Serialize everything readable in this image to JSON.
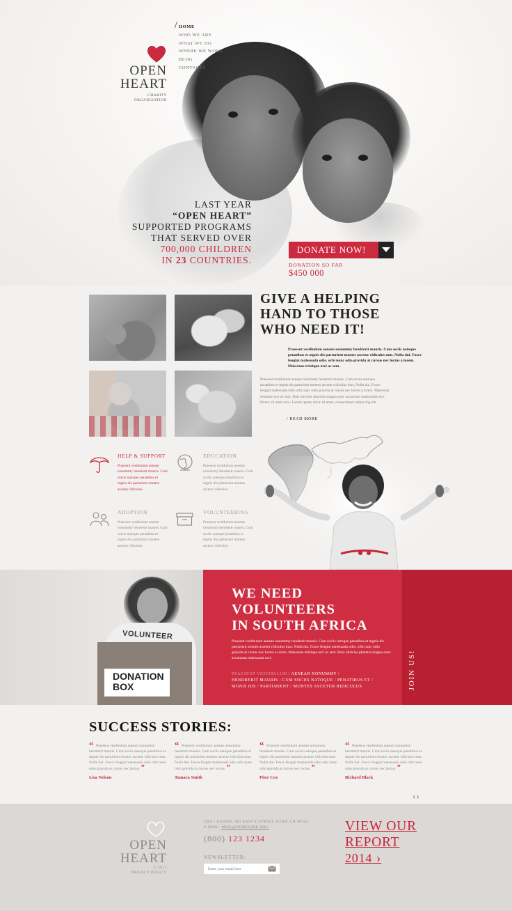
{
  "brand": {
    "name_line1": "OPEN",
    "name_line2": "HEART",
    "sub_line1": "CHARITY",
    "sub_line2": "ORGANIZATION",
    "accent_color": "#cc2b3f"
  },
  "nav": {
    "items": [
      {
        "label": "HOME",
        "active": true
      },
      {
        "label": "WHO WE ARE"
      },
      {
        "label": "WHAT WE DO"
      },
      {
        "label": "WHERE WE WORK"
      },
      {
        "label": "BLOG"
      },
      {
        "label": "CONTACTS"
      }
    ]
  },
  "hero": {
    "line1": "LAST YEAR",
    "line2": "“OPEN HEART”",
    "line3": "SUPPORTED PROGRAMS",
    "line4": "THAT SERVED OVER",
    "line5": "700,000 CHILDREN",
    "line6a": "IN ",
    "line6b": "23",
    "line6c": " COUNTRIES.",
    "donate_label": "DONATE NOW!",
    "donated_label": "DONATION SO FAR",
    "donated_amount": "$450 000"
  },
  "help": {
    "title_line1": "GIVE A HELPING",
    "title_line2": "HAND TO THOSE",
    "title_line3": "WHO NEED IT!",
    "lead": "Praesent vestibulum aenean nonummy hendrerit mauris. Cum sociis natoque penatibus et mgnis dis parturient montes ascetur ridiculus mus. Nulla dui. Fusce feugiat malesuada odio. orbi nunc odio gravida at cursus nec luctus a lorem. Maecenas tristique orci ac sem.",
    "body": "Praesent vestibulum aenean nonummy hendrerit mauris. Cum sociis natoque penatibus et mgnis dis parturient montes ascetur ridiculus mus. Nulla dui. Fusce feugiat malesuada odio orbi nunc odio gravida at cursus nec luctus a lorem. Maecenas tristique orci ac sem. Duis ultricies pharetra magna onec accumsan malesuada orci. Donec sit amet eros. Lorem ipsum dolor sit amet, consectetuer adipiscing elit.",
    "read_more": "/ READ MORE"
  },
  "features": [
    {
      "title": "HELP & SUPPORT",
      "text": "Praesent vestibulum aenean nonummy hendrerit mauris. Cum sociis natoque penatibus et mgnis dis parturient montes ascetur ridiculus.",
      "icon": "umbrella-icon"
    },
    {
      "title": "EDUCATION",
      "text": "Praesent vestibulum aenean nonummy hendrerit mauris. Cum sociis natoque penatibus et mgnis dis parturient montes ascetur ridiculus.",
      "icon": "globe-icon"
    },
    {
      "title": "ADOPTION",
      "text": "Praesent vestibulum aenean nonummy hendrerit mauris. Cum sociis natoque penatibus et mgnis dis parturient montes ascetur ridiculus.",
      "icon": "people-icon"
    },
    {
      "title": "VOLUNTEERING",
      "text": "Praesent vestibulum aenean nonummy hendrerit mauris. Cum sociis natoque penatibus et mgnis dis parturient montes ascetur ridiculus.",
      "icon": "box-icon"
    }
  ],
  "volunteers": {
    "title_line1": "WE NEED",
    "title_line2": "VOLUNTEERS",
    "title_line3": "IN SOUTH AFRICA",
    "body": "Praesent vestibulum aenean nonummy hendrerit mauris. Cum sociis natoque penatibus et mgnis dis parturient montes ascetur ridiculus mus. Nulla dui. Fusce feugiat malesuada odio. orbi nunc odio gravida at cursus nec luctus a lorem. Maecenas tristique orci ac sem. Duis ultricies pharetra magna onec accumsan malesuada orci.",
    "links_dim": "PRAESENT VESTIBULUM",
    "links_1": " / AENEAN NONUMMY /",
    "links_2": "HENDRERIT MAURIS / CUM SOCIIS NATOQUE / PENATIBUS ET /",
    "links_3": "MGNIS DIS / PARTURIENT / MONTES ASCETUR RIDICULUS",
    "join_label": "JOIN US!",
    "box_line1": "DONATION",
    "box_line2": "BOX",
    "shirt_text": "VOLUNTEER"
  },
  "success": {
    "title": "SUCCESS STORIES:",
    "quote_open": "“",
    "quote_close": "”",
    "stories": [
      {
        "text": "Praesent vestibulum aenean nonummy hendrerit mauris. Cum sociis natoque penatibus et mgnis dis parturient montes ascetur ridiculus mus. Nulla dui. Fusce feugiat malesuada odio orbi nune odio gravida at cursus nec luctus.",
        "name": "Lisa Nelson"
      },
      {
        "text": "Praesent vestibulum aenean nonummy hendrerit mauris. Cum sociis natoque penatibus et mgnis dis parturient montes ascetur ridiculus mus. Nulla dui. Fusce feugiat malesuada odio orbi nune odio gravida at cursus nec luctus.",
        "name": "Tamara Smith"
      },
      {
        "text": "Praesent vestibulum aenean nonummy hendrerit mauris. Cum sociis natoque penatibus et mgnis dis parturient montes ascetur ridiculus mus. Nulla dui. Fusce feugiat malesuada odio orbi nune odio gravida at cursus nec luctus.",
        "name": "Piter Cox"
      },
      {
        "text": "Praesent vestibulum aenean nonummy hendrerit mauris. Cum sociis natoque penatibus et mgnis dis parturient montes ascetur ridiculus mus. Nulla dui. Fusce feugiat malesuada odio orbi nune odio gravida at cursus nec luctus.",
        "name": "Richard Black"
      }
    ],
    "prev": "‹",
    "next": "›"
  },
  "footer": {
    "logo_line1": "OPEN",
    "logo_line2": "HEART",
    "copyright": "© 2013",
    "privacy": "PRIVACY POLICY",
    "address": "USA – AUSTIN, 901 EAST E STREET, UTAH, CA 90744",
    "email_label": "E-MAIL:",
    "email": "MAIL@DEMOLINK.ORG",
    "phone_prefix": "(800) ",
    "phone": "123 1234",
    "newsletter_label": "NEWSLETTER:",
    "newsletter_placeholder": "Enter your email here",
    "report_line1": "VIEW OUR",
    "report_line2": "REPORT",
    "report_year": "2014",
    "report_arrow": "›"
  }
}
